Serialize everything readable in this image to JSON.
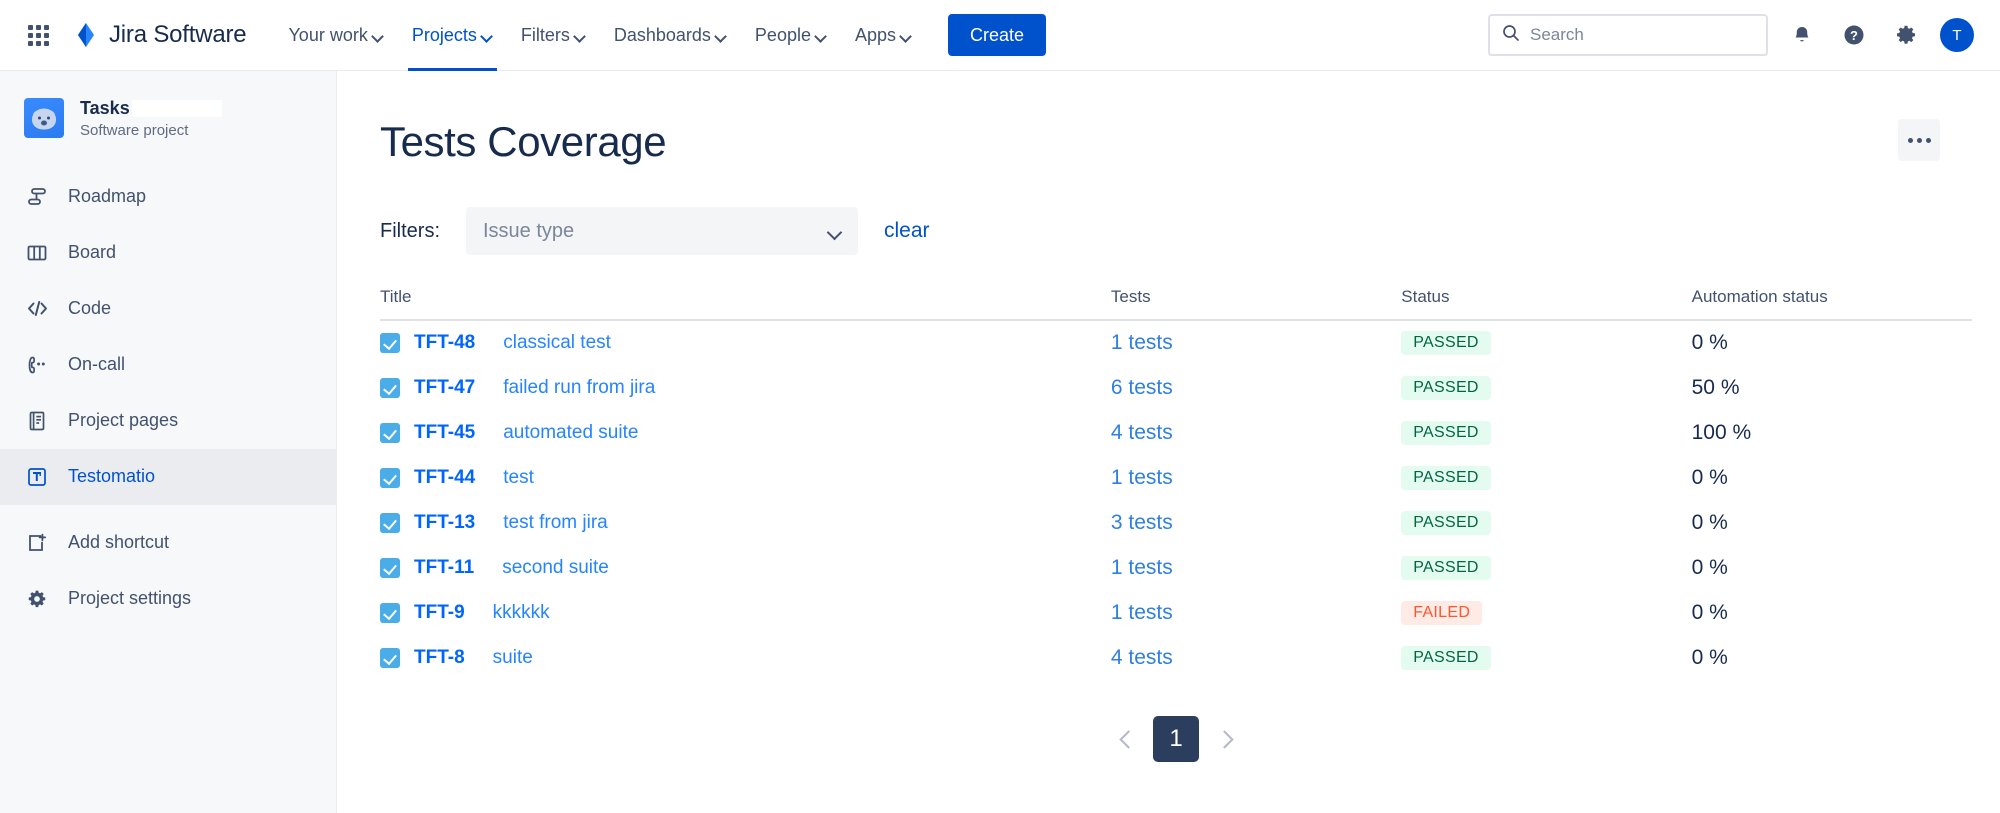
{
  "topnav": {
    "apps_icon": "apps-grid-icon",
    "brand": "Jira Software",
    "items": [
      {
        "label": "Your work",
        "active": false
      },
      {
        "label": "Projects",
        "active": true
      },
      {
        "label": "Filters",
        "active": false
      },
      {
        "label": "Dashboards",
        "active": false
      },
      {
        "label": "People",
        "active": false
      },
      {
        "label": "Apps",
        "active": false
      }
    ],
    "create_label": "Create",
    "search": {
      "value": "",
      "placeholder": "Search"
    },
    "notifications_icon": "notification-bell-icon",
    "help_icon": "help-question-icon",
    "settings_icon": "gear-icon",
    "avatar_initial": "T"
  },
  "sidebar": {
    "project_name": "Tasks",
    "project_subtitle": "Software project",
    "project_avatar_icon": "koala-project-avatar",
    "items": [
      {
        "label": "Roadmap",
        "icon": "roadmap-icon",
        "selected": false
      },
      {
        "label": "Board",
        "icon": "board-columns-icon",
        "selected": false
      },
      {
        "label": "Code",
        "icon": "code-brackets-icon",
        "selected": false
      },
      {
        "label": "On-call",
        "icon": "on-call-phone-icon",
        "selected": false
      },
      {
        "label": "Project pages",
        "icon": "project-pages-icon",
        "selected": false
      },
      {
        "label": "Testomatio",
        "icon": "testomatio-icon",
        "selected": true
      }
    ],
    "footer_items": [
      {
        "label": "Add shortcut",
        "icon": "add-shortcut-icon"
      },
      {
        "label": "Project settings",
        "icon": "gear-icon"
      }
    ]
  },
  "main": {
    "title": "Tests Coverage",
    "more_icon": "ellipsis-icon",
    "filters": {
      "label": "Filters:",
      "issue_type": {
        "value": "",
        "placeholder": "Issue type"
      },
      "clear_label": "clear"
    },
    "table": {
      "headers": [
        "Title",
        "Tests",
        "Status",
        "Automation status"
      ],
      "rows": [
        {
          "key": "TFT-48",
          "summary": "classical test",
          "tests": "1 tests",
          "status": "PASSED",
          "status_kind": "passed",
          "automation": "0 %"
        },
        {
          "key": "TFT-47",
          "summary": "failed run from jira",
          "tests": "6 tests",
          "status": "PASSED",
          "status_kind": "passed",
          "automation": "50 %"
        },
        {
          "key": "TFT-45",
          "summary": "automated suite",
          "tests": "4 tests",
          "status": "PASSED",
          "status_kind": "passed",
          "automation": "100 %"
        },
        {
          "key": "TFT-44",
          "summary": "test",
          "tests": "1 tests",
          "status": "PASSED",
          "status_kind": "passed",
          "automation": "0 %"
        },
        {
          "key": "TFT-13",
          "summary": "test from jira",
          "tests": "3 tests",
          "status": "PASSED",
          "status_kind": "passed",
          "automation": "0 %"
        },
        {
          "key": "TFT-11",
          "summary": "second suite",
          "tests": "1 tests",
          "status": "PASSED",
          "status_kind": "passed",
          "automation": "0 %"
        },
        {
          "key": "TFT-9",
          "summary": "kkkkkk",
          "tests": "1 tests",
          "status": "FAILED",
          "status_kind": "failed",
          "automation": "0 %"
        },
        {
          "key": "TFT-8",
          "summary": "suite",
          "tests": "4 tests",
          "status": "PASSED",
          "status_kind": "passed",
          "automation": "0 %"
        }
      ]
    },
    "pagination": {
      "prev_icon": "chevron-left-icon",
      "next_icon": "chevron-right-icon",
      "current_page": "1"
    }
  },
  "colors": {
    "brand_blue": "#0052cc",
    "link_blue": "#2684ff",
    "passed_bg": "#e3fcef",
    "passed_fg": "#006644",
    "failed_bg": "#ffebe6",
    "failed_fg": "#ff5630",
    "pager_active": "#2c3e5d"
  }
}
